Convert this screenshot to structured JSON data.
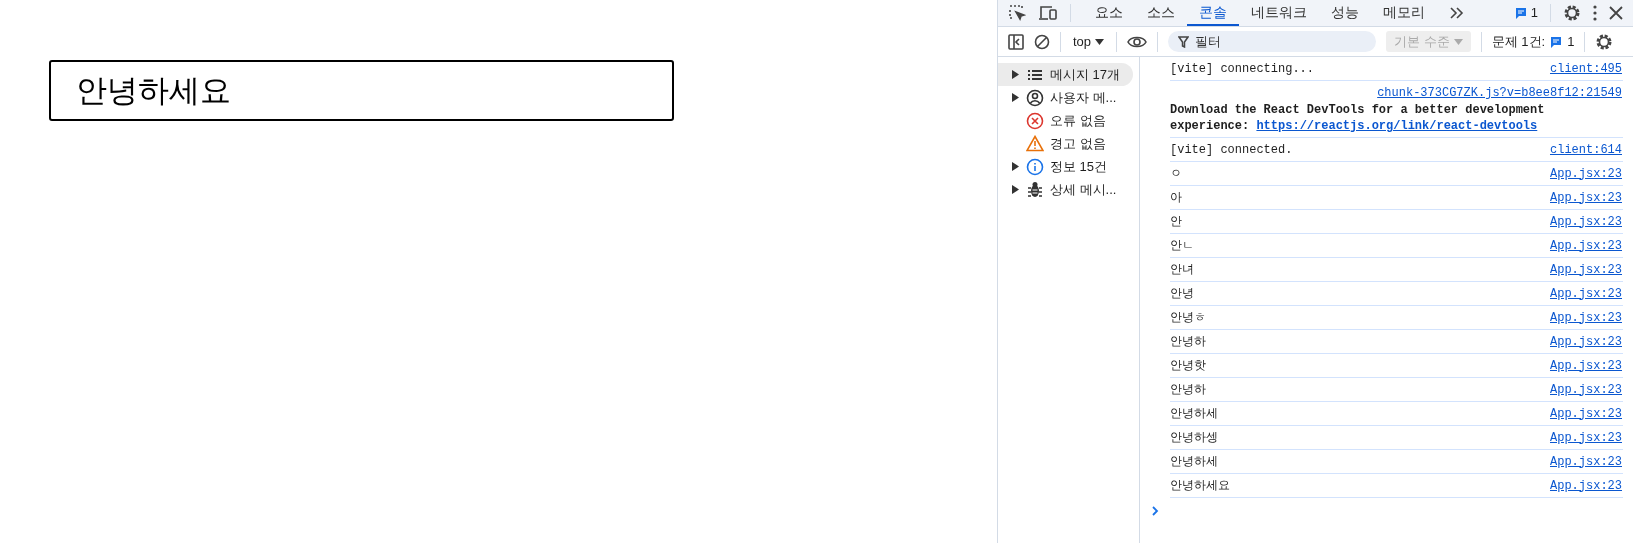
{
  "page": {
    "input": {
      "value": "안녕하세요"
    }
  },
  "devtools": {
    "tabs": [
      {
        "label": "요소",
        "selected": false
      },
      {
        "label": "소스",
        "selected": false
      },
      {
        "label": "콘솔",
        "selected": true
      },
      {
        "label": "네트워크",
        "selected": false
      },
      {
        "label": "성능",
        "selected": false
      },
      {
        "label": "메모리",
        "selected": false
      }
    ],
    "message_badge": "1",
    "toolbar": {
      "context": "top",
      "filter": {
        "placeholder": "필터"
      },
      "levels": "기본 수준",
      "issues_label": "문제 1건:",
      "issues_count": "1"
    },
    "sidebar": [
      {
        "kind": "messages",
        "label": "메시지 17개",
        "expandable": true,
        "selected": true
      },
      {
        "kind": "user",
        "label": "사용자 메...",
        "expandable": true,
        "selected": false
      },
      {
        "kind": "errors",
        "label": "오류 없음",
        "expandable": false,
        "selected": false
      },
      {
        "kind": "warnings",
        "label": "경고 없음",
        "expandable": false,
        "selected": false
      },
      {
        "kind": "info",
        "label": "정보 15건",
        "expandable": true,
        "selected": false
      },
      {
        "kind": "verbose",
        "label": "상세 메시...",
        "expandable": true,
        "selected": false
      }
    ],
    "messages": [
      {
        "kind": "log",
        "text": "[vite] connecting...",
        "source": "client:495"
      },
      {
        "kind": "notice",
        "source": "chunk-373CG7ZK.js?v=b8ee8f12:21549",
        "text": "Download the React DevTools for a better development experience: ",
        "link": "https://reactjs.org/link/react-devtools"
      },
      {
        "kind": "log",
        "text": "[vite] connected.",
        "source": "client:614"
      },
      {
        "kind": "log",
        "text": "ㅇ",
        "source": "App.jsx:23"
      },
      {
        "kind": "log",
        "text": "아",
        "source": "App.jsx:23"
      },
      {
        "kind": "log",
        "text": "안",
        "source": "App.jsx:23"
      },
      {
        "kind": "log",
        "text": "안ㄴ",
        "source": "App.jsx:23"
      },
      {
        "kind": "log",
        "text": "안녀",
        "source": "App.jsx:23"
      },
      {
        "kind": "log",
        "text": "안녕",
        "source": "App.jsx:23"
      },
      {
        "kind": "log",
        "text": "안녕ㅎ",
        "source": "App.jsx:23"
      },
      {
        "kind": "log",
        "text": "안녕하",
        "source": "App.jsx:23"
      },
      {
        "kind": "log",
        "text": "안녕핫",
        "source": "App.jsx:23"
      },
      {
        "kind": "log",
        "text": "안녕하",
        "source": "App.jsx:23"
      },
      {
        "kind": "log",
        "text": "안녕하세",
        "source": "App.jsx:23"
      },
      {
        "kind": "log",
        "text": "안녕하셍",
        "source": "App.jsx:23"
      },
      {
        "kind": "log",
        "text": "안녕하세",
        "source": "App.jsx:23"
      },
      {
        "kind": "log",
        "text": "안녕하세요",
        "source": "App.jsx:23"
      }
    ]
  }
}
